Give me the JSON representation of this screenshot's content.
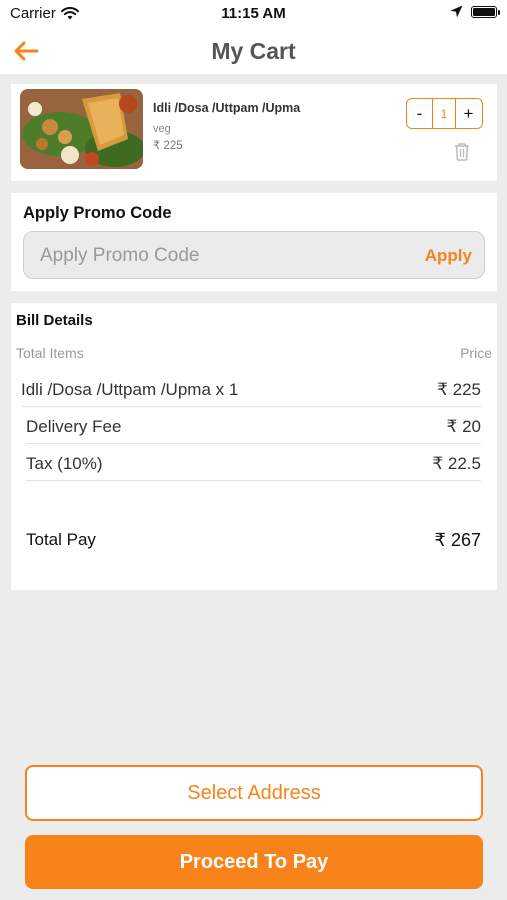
{
  "status_bar": {
    "carrier": "Carrier",
    "time": "11:15 AM",
    "icons": [
      "wifi-icon",
      "location-arrow-icon",
      "battery-icon"
    ]
  },
  "nav": {
    "title": "My Cart",
    "back_icon": "arrow-left-icon"
  },
  "cart_item": {
    "name": "Idli /Dosa /Uttpam /Upma",
    "tag": "veg",
    "price": "₹ 225",
    "quantity": "1",
    "minus_label": "-",
    "plus_label": "+",
    "delete_icon": "trash-icon"
  },
  "promo": {
    "title": "Apply Promo Code",
    "placeholder": "Apply Promo Code",
    "value": "",
    "apply_label": "Apply"
  },
  "bill": {
    "title": "Bill Details",
    "col_items": "Total Items",
    "col_price": "Price",
    "rows": [
      {
        "label": "Idli /Dosa /Uttpam /Upma x 1",
        "value": "₹ 225"
      },
      {
        "label": "Delivery Fee",
        "value": "₹ 20"
      },
      {
        "label": "Tax (10%)",
        "value": "₹ 22.5"
      }
    ],
    "total_label": "Total Pay",
    "total_value": "₹ 267"
  },
  "actions": {
    "select_address": "Select Address",
    "proceed_to_pay": "Proceed To Pay"
  },
  "colors": {
    "accent": "#f7831a",
    "background": "#ececec"
  }
}
